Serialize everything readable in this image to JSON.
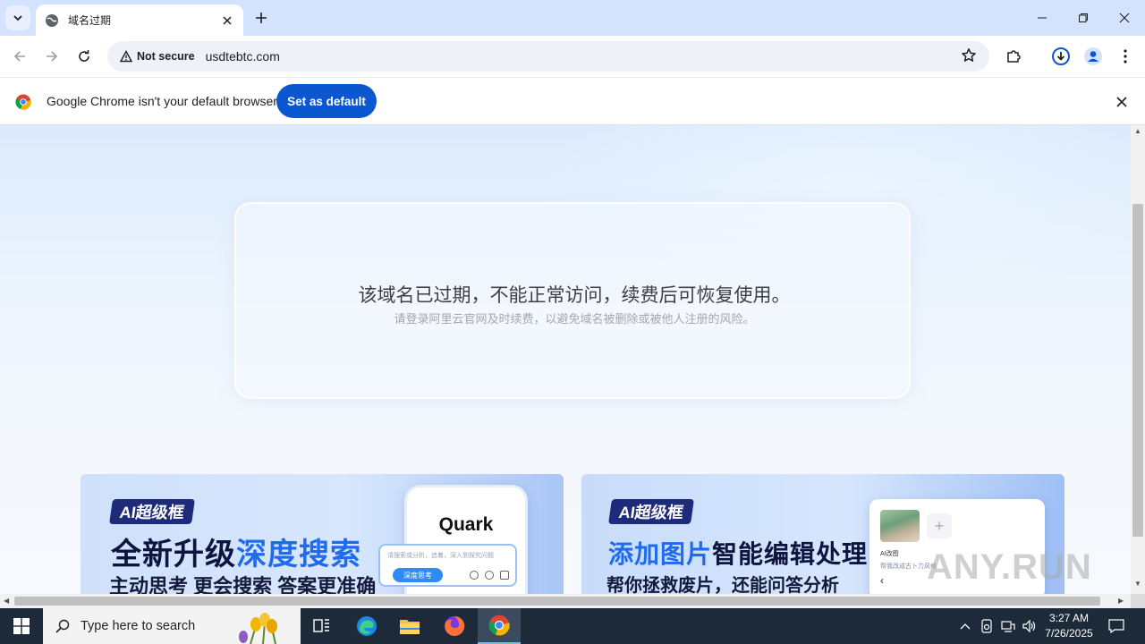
{
  "browser": {
    "tab_title": "域名过期",
    "address_security": "Not secure",
    "url": "usdtebtc.com"
  },
  "infobar": {
    "message": "Google Chrome isn't your default browser",
    "button_label": "Set as default"
  },
  "page": {
    "main_message": "该域名已过期，不能正常访问，续费后可恢复使用。",
    "sub_message": "请登录阿里云官网及时续费，以避免域名被删除或被他人注册的风险。"
  },
  "banners": [
    {
      "tag": "AI超级框",
      "title_prefix": "全新升级",
      "title_highlight": "深度搜索",
      "subtitle": "主动思考 更会搜索 答案更准确",
      "app_name": "Quark",
      "search_placeholder": "请搜索或分析，追着，深入到探究问题",
      "search_button": "深度思考"
    },
    {
      "tag": "AI超级框",
      "title_prefix": "添加图片",
      "title_suffix": "智能编辑处理",
      "subtitle": "帮你拯救废片，还能问答分析",
      "panel_label": "AI改图",
      "panel_text": "帮我改成古卜力风格"
    }
  ],
  "watermark": "ANY.RUN",
  "taskbar": {
    "search_placeholder": "Type here to search",
    "time": "3:27 AM",
    "date": "7/26/2025"
  },
  "colors": {
    "tabstrip": "#d3e3fd",
    "primary_button": "#0b57d0",
    "taskbar": "#1c2a3a",
    "banner_highlight": "#1f6bf0"
  }
}
